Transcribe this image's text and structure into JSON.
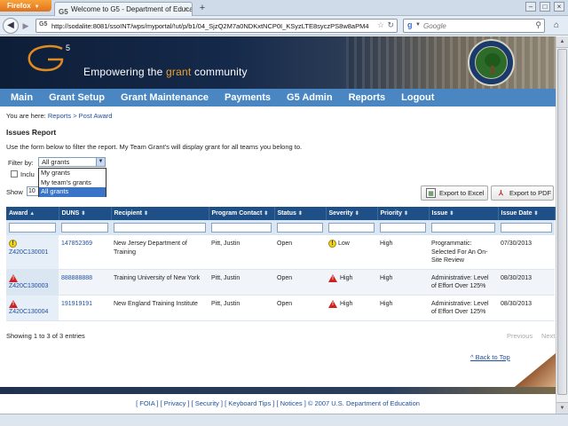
{
  "browser": {
    "menu_button": "Firefox",
    "tab_title": "Welcome to G5 - Department of Educatio...",
    "favicon": "G5",
    "url": "http://sodalite:8081/ssoINT/wps/myportal/!ut/p/b1/04_SjzQ2M7a0NDKxtNCP0I_KSyzLTE8syczPS8w8aPM4",
    "search_placeholder": "Google",
    "icons": [
      "back-icon",
      "forward-icon",
      "star-icon",
      "reload-icon",
      "search-icon",
      "home-icon"
    ]
  },
  "banner": {
    "tagline_pre": "Empowering the ",
    "tagline_accent": "grant",
    "tagline_post": " community",
    "logo_sup": "5"
  },
  "menu": [
    "Main",
    "Grant Setup",
    "Grant Maintenance",
    "Payments",
    "G5 Admin",
    "Reports",
    "Logout"
  ],
  "breadcrumb": {
    "prefix": "You are here: ",
    "links": "Reports > Post Award"
  },
  "page": {
    "title": "Issues Report",
    "instructions": "Use the form below to filter the report. My Team Grant's will display grant for all teams you belong to."
  },
  "filter": {
    "label": "Filter by:",
    "selected": "All grants",
    "options": [
      "My grants",
      "My team's grants",
      "All grants"
    ],
    "include_label": "Inclu",
    "show_label": "Show",
    "show_value": "10"
  },
  "buttons": {
    "excel": "Export to Excel",
    "pdf": "Export to PDF"
  },
  "table": {
    "headers": [
      "Award",
      "DUNS",
      "Recipient",
      "Program Contact",
      "Status",
      "Severity",
      "Priority",
      "Issue",
      "Issue Date"
    ],
    "sort_asc": "▲",
    "sort_both": "⬍",
    "rows": [
      {
        "award": "Z420C130001",
        "award_icon": "warning-yellow-icon",
        "duns": "147852369",
        "recipient": "New Jersey Department of Training",
        "contact": "Pitt, Justin",
        "status": "Open",
        "severity": "Low",
        "severity_icon": "warning-yellow-icon",
        "priority": "High",
        "issue": "Programmatic: Selected For An On-Site Review",
        "date": "07/30/2013"
      },
      {
        "award": "Z420C130003",
        "award_icon": "warning-red-icon",
        "duns": "888888888",
        "recipient": "Training University of New York",
        "contact": "Pitt, Justin",
        "status": "Open",
        "severity": "High",
        "severity_icon": "warning-red-icon",
        "priority": "High",
        "issue": "Administrative: Level of Effort Over 125%",
        "date": "08/30/2013"
      },
      {
        "award": "Z420C130004",
        "award_icon": "warning-red-icon",
        "duns": "191919191",
        "recipient": "New England Training Institute",
        "contact": "Pitt, Justin",
        "status": "Open",
        "severity": "High",
        "severity_icon": "warning-red-icon",
        "priority": "High",
        "issue": "Administrative: Level of Effort Over 125%",
        "date": "08/30/2013"
      }
    ]
  },
  "pagination": {
    "entries": "Showing 1 to 3 of 3 entries",
    "previous": "Previous",
    "next": "Next"
  },
  "back_to_top": "^ Back to Top",
  "footer": "[ FOIA ] [ Privacy ] [ Security ] [ Keyboard Tips ] [ Notices ] © 2007 U.S. Department of Education",
  "colors": {
    "menu_bar": "#4a86c2",
    "table_header": "#1f4f87",
    "link": "#1f4fa0",
    "banner_accent": "#f0a030"
  }
}
